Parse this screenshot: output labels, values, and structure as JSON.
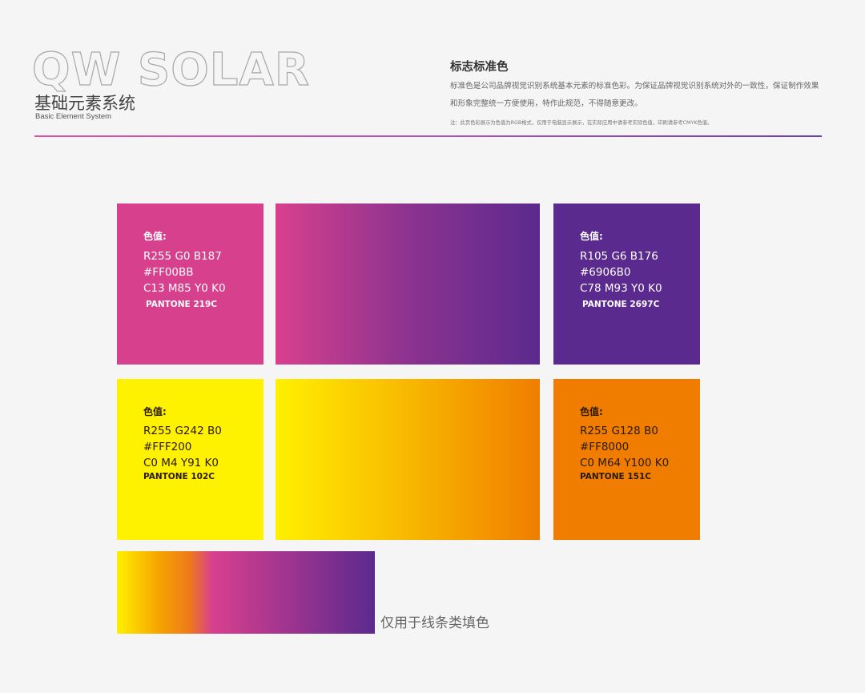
{
  "header": {
    "logo_text": "QW SOLAR",
    "title_cn": "基础元素系统",
    "title_en": "Basic Element System"
  },
  "section": {
    "title": "标志标准色",
    "description": "标准色是公司品牌视觉识别系统基本元素的标准色彩。为保证品牌视觉识别系统对外的一致性，保证制作效果和形象完整统一方便使用，特作此规范，不得随意更改。",
    "note": "注：此页色彩展示为色值为RGB格式，仅用于电脑显示展示，在实际应用中请参考实际色值，印刷请参考CMYK色值。"
  },
  "swatches": {
    "magenta": {
      "label": "色值:",
      "rgb": "R255 G0 B187",
      "hex": "#FF00BB",
      "cmyk": "C13  M85 Y0  K0",
      "pantone": "PANTONE 219C",
      "color": "#D6408C"
    },
    "purple": {
      "label": "色值:",
      "rgb": "R105 G6 B176",
      "hex": "#6906B0",
      "cmyk": "C78  M93 Y0  K0",
      "pantone": "PANTONE 2697C",
      "color": "#5B2A8E"
    },
    "yellow": {
      "label": "色值:",
      "rgb": "R255 G242 B0",
      "hex": "#FFF200",
      "cmyk": "C0  M4 Y91  K0",
      "pantone": "PANTONE 102C",
      "color": "#FFF200"
    },
    "orange": {
      "label": "色值:",
      "rgb": "R255 G128 B0",
      "hex": "#FF8000",
      "cmyk": "C0  M64 Y100  K0",
      "pantone": "PANTONE 151C",
      "color": "#F07D00"
    }
  },
  "gradient_note": "仅用于线条类填色"
}
